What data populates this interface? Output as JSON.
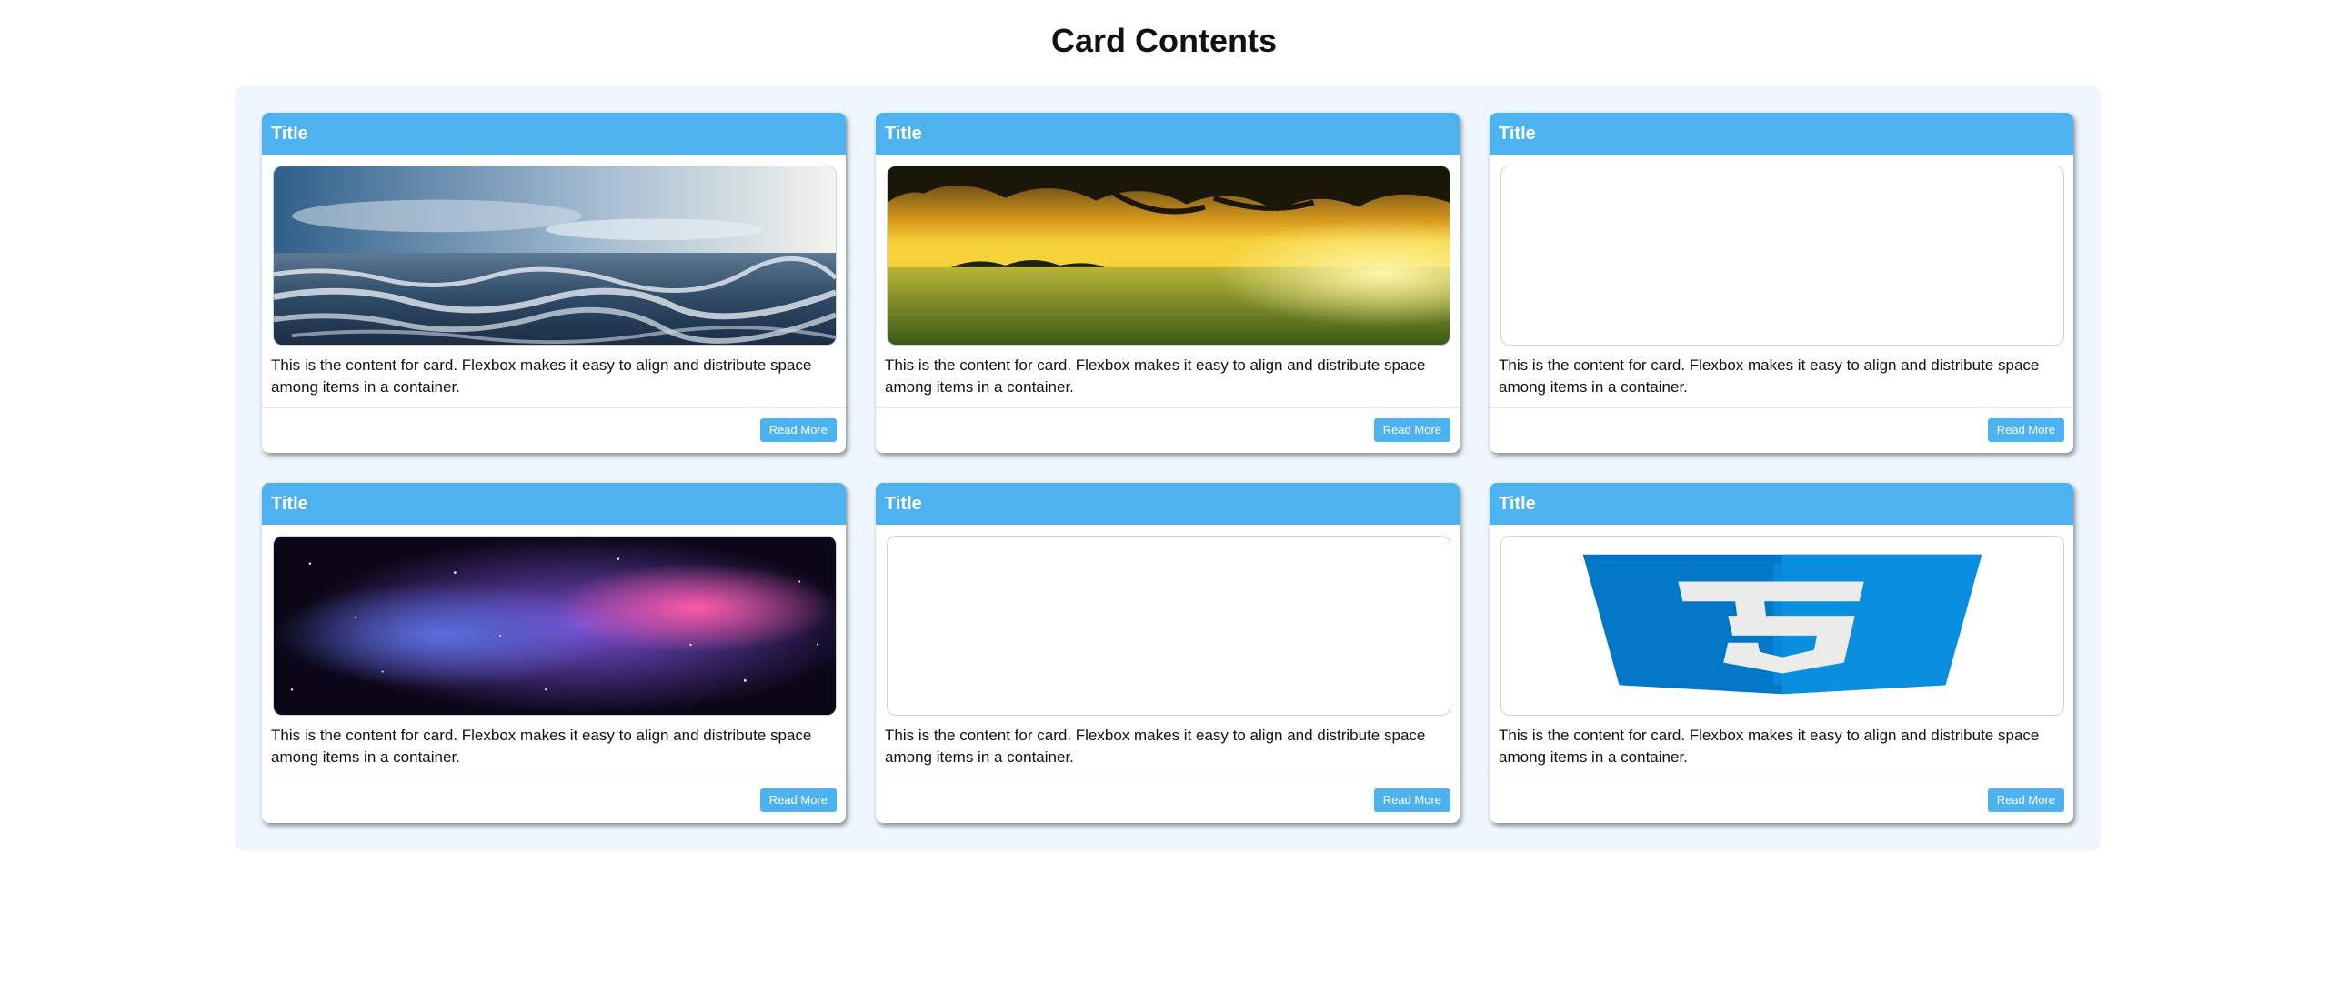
{
  "page": {
    "title": "Card Contents"
  },
  "cards": [
    {
      "title": "Title",
      "image": "ocean-waves-image",
      "content": "This is the content for card. Flexbox makes it easy to align and distribute space among items in a container.",
      "button": "Read More"
    },
    {
      "title": "Title",
      "image": "sunset-field-image",
      "content": "This is the content for card. Flexbox makes it easy to align and distribute space among items in a container.",
      "button": "Read More"
    },
    {
      "title": "Title",
      "image": "empty-image",
      "content": "This is the content for card. Flexbox makes it easy to align and distribute space among items in a container.",
      "button": "Read More"
    },
    {
      "title": "Title",
      "image": "nebula-image",
      "content": "This is the content for card. Flexbox makes it easy to align and distribute space among items in a container.",
      "button": "Read More"
    },
    {
      "title": "Title",
      "image": "empty-image",
      "content": "This is the content for card. Flexbox makes it easy to align and distribute space among items in a container.",
      "button": "Read More"
    },
    {
      "title": "Title",
      "image": "css3-logo",
      "content": "This is the content for card. Flexbox makes it easy to align and distribute space among items in a container.",
      "button": "Read More"
    }
  ],
  "colors": {
    "accent": "#4cb2f0",
    "container_bg": "#eef7ff",
    "css3_blue": "#0277c8"
  }
}
